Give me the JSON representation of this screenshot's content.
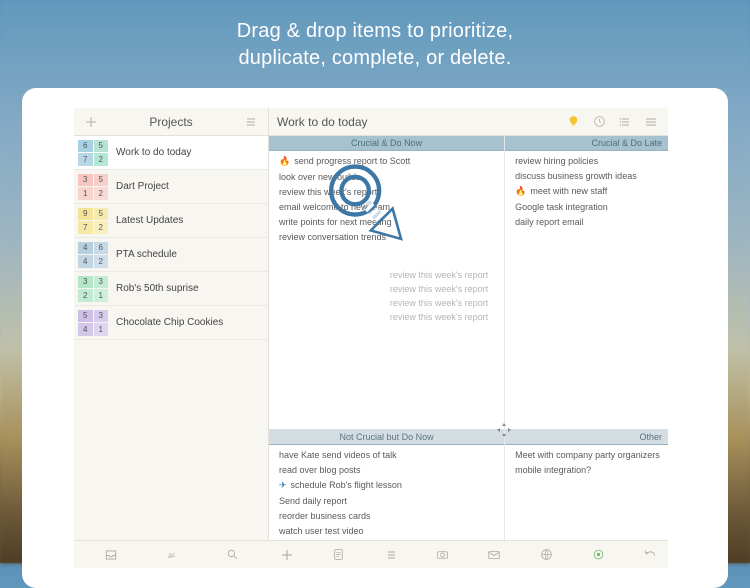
{
  "headline_l1": "Drag & drop items to prioritize,",
  "headline_l2": "duplicate, complete, or delete.",
  "sidebar": {
    "title": "Projects",
    "projects": [
      {
        "label": "Work to do today",
        "nums": [
          "6",
          "5",
          "7",
          "2"
        ],
        "colors": [
          "#a8d1e6",
          "#b8e2d2",
          "#b8d6e6",
          "#b4e6d4"
        ]
      },
      {
        "label": "Dart Project",
        "nums": [
          "3",
          "5",
          "1",
          "2"
        ],
        "colors": [
          "#f7c6c0",
          "#f7cfc9",
          "#f8d4cf",
          "#f9dad6"
        ]
      },
      {
        "label": "Latest Updates",
        "nums": [
          "9",
          "5",
          "7",
          "2"
        ],
        "colors": [
          "#f3e49a",
          "#f6eab0",
          "#f5e8a8",
          "#f8eec0"
        ]
      },
      {
        "label": "PTA schedule",
        "nums": [
          "4",
          "6",
          "4",
          "2"
        ],
        "colors": [
          "#b7cfe0",
          "#c6d9e6",
          "#c2d5e3",
          "#cfdfe9"
        ]
      },
      {
        "label": "Rob's 50th suprise",
        "nums": [
          "3",
          "3",
          "2",
          "1"
        ],
        "colors": [
          "#b4e6c9",
          "#c4ecd4",
          "#c0ead1",
          "#ceefdb"
        ]
      },
      {
        "label": "Chocolate Chip Cookies",
        "nums": [
          "5",
          "3",
          "4",
          "1"
        ],
        "colors": [
          "#cdbfe6",
          "#d7ccec",
          "#d3c8ea",
          "#ded6f0"
        ]
      }
    ]
  },
  "main": {
    "title": "Work to do today",
    "quadrants": {
      "q1": {
        "header": "Crucial & Do Now",
        "tasks": [
          {
            "icon": "fire",
            "text": "send progress report to Scott"
          },
          {
            "text": "look over new builds"
          },
          {
            "text": "review this week's report"
          },
          {
            "text": "email welcome to new team"
          },
          {
            "text": "write points for next meeting"
          },
          {
            "text": "review conversation trends"
          }
        ],
        "ghosts": [
          "review this week's report",
          "review this week's report",
          "review this week's report",
          "review this week's report"
        ]
      },
      "q2": {
        "header": "Crucial & Do Late",
        "tasks": [
          {
            "text": "review hiring policies"
          },
          {
            "text": "discuss business growth ideas"
          },
          {
            "icon": "fire",
            "text": "meet with new staff"
          },
          {
            "text": "Google task integration"
          },
          {
            "text": "daily report email"
          }
        ]
      },
      "q3": {
        "header": "Not Crucial but Do Now",
        "tasks": [
          {
            "text": "have Kate send videos of talk"
          },
          {
            "text": "read over blog posts"
          },
          {
            "icon": "plane",
            "text": "schedule Rob's flight lesson"
          },
          {
            "text": "Send daily report"
          },
          {
            "text": "reorder business cards"
          },
          {
            "text": "watch user test video"
          }
        ]
      },
      "q4": {
        "header": "Other",
        "tasks": [
          {
            "text": "Meet with company party organizers"
          },
          {
            "text": "mobile integration?"
          }
        ]
      }
    }
  }
}
